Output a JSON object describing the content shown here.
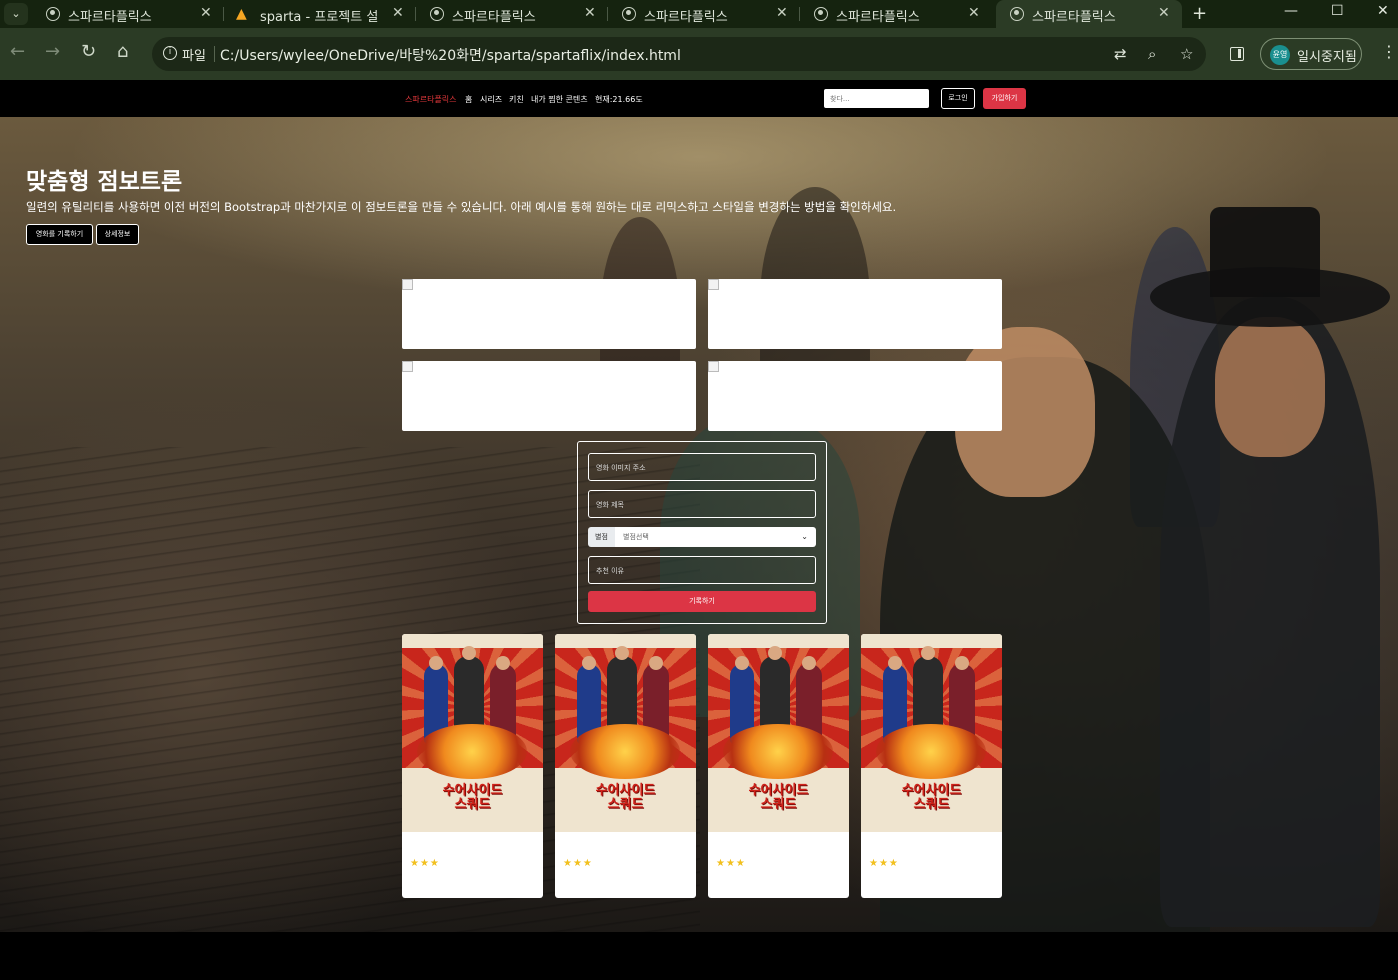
{
  "browser": {
    "tabs": [
      {
        "title": "스파르타플릭스",
        "icon": "globe-icon"
      },
      {
        "title": "sparta - 프로젝트 설정",
        "icon": "firebase-icon"
      },
      {
        "title": "스파르타플릭스",
        "icon": "globe-icon"
      },
      {
        "title": "스파르타플릭스",
        "icon": "globe-icon"
      },
      {
        "title": "스파르타플릭스",
        "icon": "globe-icon"
      },
      {
        "title": "스파르타플릭스",
        "icon": "globe-icon"
      }
    ],
    "active_tab": 5,
    "address": {
      "scheme_label": "파일",
      "url": "C:/Users/wylee/OneDrive/바탕%20화면/sparta/spartaflix/index.html"
    },
    "profile": {
      "avatar_text": "윤영",
      "label": "일시중지됨"
    }
  },
  "site": {
    "nav": {
      "brand": "스파르타플릭스",
      "items": [
        "홈",
        "시리즈",
        "키친",
        "내가 찜한 콘텐츠",
        "현재:21.66도"
      ],
      "search_placeholder": "찾다...",
      "login": "로그인",
      "signup": "가입하기"
    },
    "hero": {
      "title": "맞춤형 점보트론",
      "description": "일련의 유틸리티를 사용하면 이전 버전의 Bootstrap과 마찬가지로 이 점보트론을 만들 수 있습니다. 아래 예시를 통해 원하는 대로 리믹스하고 스타일을 변경하는 방법을 확인하세요.",
      "buttons": [
        "영화를 기록하기",
        "상세정보"
      ]
    },
    "form": {
      "image_placeholder": "영화 이미지 주소",
      "title_placeholder": "영화 제목",
      "genre_label": "별점",
      "genre_value": "별점선택",
      "reason_placeholder": "추천 이유",
      "submit": "기록하기"
    },
    "cards": [
      {
        "poster_title": "수어사이드\n스쿼드",
        "stars": "★★★",
        "rating": 3
      },
      {
        "poster_title": "수어사이드\n스쿼드",
        "stars": "★★★",
        "rating": 3
      },
      {
        "poster_title": "수어사이드\n스쿼드",
        "stars": "★★★",
        "rating": 3
      },
      {
        "poster_title": "수어사이드\n스쿼드",
        "stars": "★★★",
        "rating": 3
      }
    ]
  },
  "colors": {
    "accent": "#dc3545",
    "brand": "#e5383b",
    "star": "#f2c01e",
    "tabstrip": "#15230f",
    "toolbar": "#2b3b25"
  }
}
